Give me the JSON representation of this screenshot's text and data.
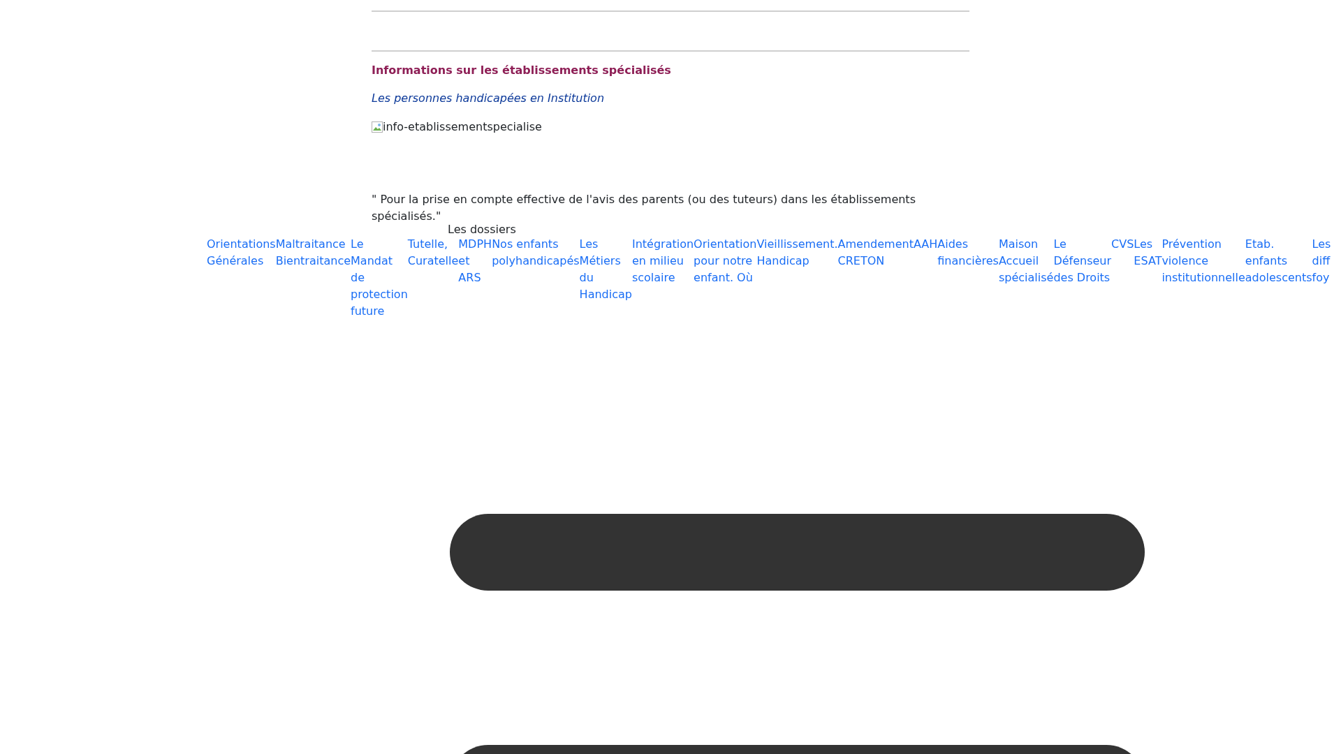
{
  "section": {
    "heading": "Informations sur les établissements spécialisés",
    "subtitle": "Les personnes handicapées en Institution",
    "image_alt": "info-etablissementspecialise",
    "quote": "\" Pour la prise en compte effective de l'avis des parents (ou des tuteurs) dans les établissements spécialisés.\""
  },
  "menu": {
    "label": "Les dossiers",
    "links": [
      "Orientations Générales",
      "Maltraitance Bientraitance",
      "Le Mandat de protection future",
      "Tutelle, Curatelle",
      "MDPH et ARS",
      "Nos enfants polyhandicapés",
      "Les Métiers du Handicap",
      "Intégration en milieu scolaire",
      "Orientation pour notre enfant. Où",
      "Vieillissement. Handicap",
      "Amendement CRETON",
      "AAH",
      "Aides financières",
      "Maison Accueil spécialisé",
      "Le Défenseur des Droits",
      "CVS",
      "Les ESAT",
      "Prévention violence institutionnelle",
      "Etab. enfants adolescents",
      "Les diff foy"
    ]
  }
}
